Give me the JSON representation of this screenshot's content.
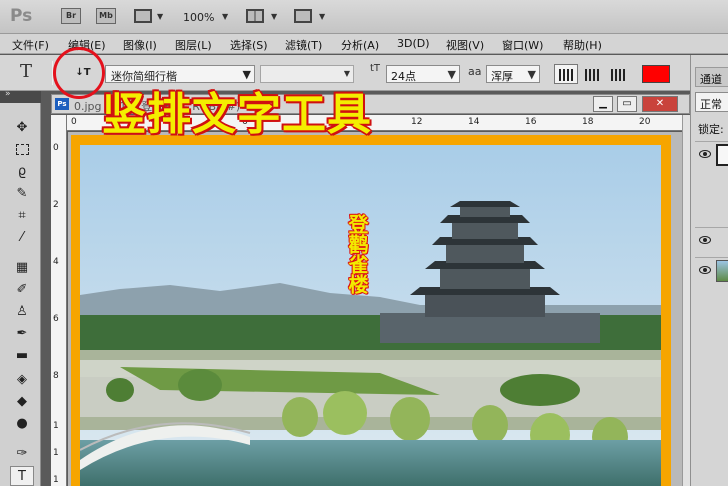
{
  "app": {
    "logo": "Ps",
    "bridge_btn": "Br",
    "minibridge_btn": "Mb",
    "zoom": "100%"
  },
  "menu": [
    "文件(F)",
    "编辑(E)",
    "图像(I)",
    "图层(L)",
    "选择(S)",
    "滤镜(T)",
    "分析(A)",
    "3D(D)",
    "视图(V)",
    "窗口(W)",
    "帮助(H)"
  ],
  "options": {
    "tool_glyph": "T",
    "orientation_glyph": "↓T",
    "font_family": "迷你简细行楷",
    "font_size": "24点",
    "aa_label": "aa",
    "antialias": "浑厚",
    "text_color": "#ff0000"
  },
  "annotation": {
    "title": "竖排文字工具",
    "vertical_text": "登鹳雀楼"
  },
  "document": {
    "ps_badge": "Ps",
    "tab_title": "0.jpg @ 1...(登鹳雀楼, RGB/8#) *"
  },
  "ruler": {
    "top": [
      "0",
      "2",
      "4",
      "6",
      "8",
      "10",
      "12",
      "14",
      "16",
      "18",
      "20"
    ],
    "left": [
      "0",
      "2",
      "4",
      "6",
      "8",
      "1",
      "1",
      "1"
    ]
  },
  "layers_panel": {
    "tab": "通道",
    "blend_mode": "正常",
    "lock_label": "锁定:"
  }
}
